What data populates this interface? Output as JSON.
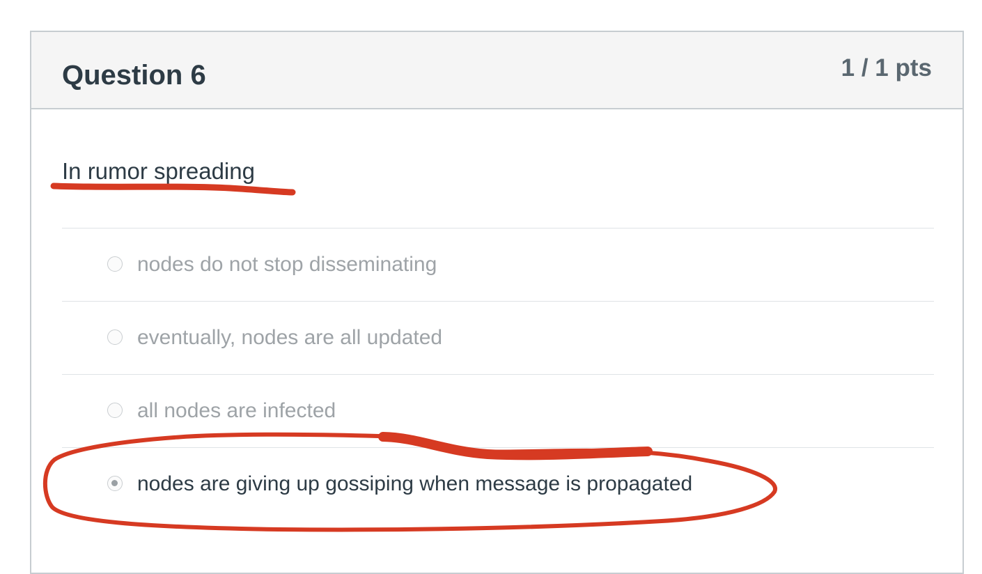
{
  "question": {
    "title": "Question 6",
    "points": "1 / 1 pts",
    "text": "In rumor spreading"
  },
  "answers": [
    {
      "label": "nodes do not stop disseminating",
      "selected": false
    },
    {
      "label": "eventually, nodes are all updated",
      "selected": false
    },
    {
      "label": "all nodes are infected",
      "selected": false
    },
    {
      "label": "nodes are giving up gossiping when message is propagated",
      "selected": true
    }
  ],
  "annotation_color": "#d63a22"
}
